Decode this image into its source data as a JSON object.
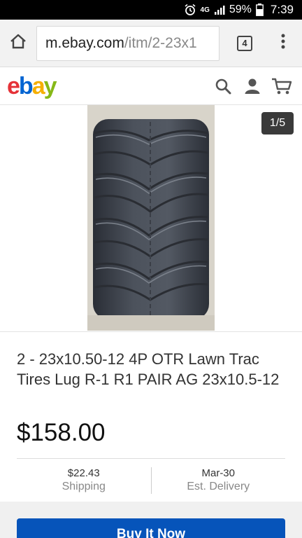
{
  "status_bar": {
    "network": "4G",
    "battery": "59%",
    "time": "7:39"
  },
  "browser": {
    "url_host": "m.ebay.com",
    "url_path": "/itm/2-23x1",
    "tab_count": "4"
  },
  "site": {
    "logo": {
      "e": "e",
      "b": "b",
      "a": "a",
      "y": "y"
    },
    "logo_colors": [
      "#e53238",
      "#0064d2",
      "#f5af02",
      "#86b817"
    ]
  },
  "header_icons": [
    "search-icon",
    "account-icon",
    "cart-icon"
  ],
  "gallery": {
    "counter": "1/5"
  },
  "listing": {
    "title": "2 - 23x10.50-12 4P OTR Lawn Trac Tires Lug R-1 R1 PAIR AG 23x10.5-12",
    "price": "$158.00",
    "shipping_value": "$22.43",
    "shipping_label": "Shipping",
    "delivery_value": "Mar-30",
    "delivery_label": "Est. Delivery"
  },
  "actions": {
    "buy_label": "Buy It Now"
  },
  "colors": {
    "buy_button": "#0654ba"
  }
}
